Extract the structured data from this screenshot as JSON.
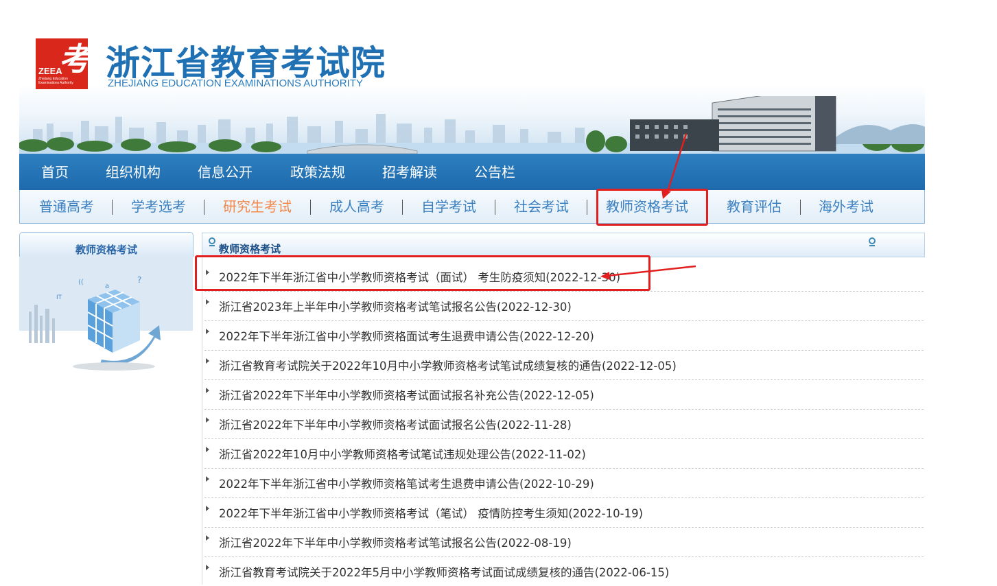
{
  "header": {
    "logo_char": "考",
    "logo_abbr": "ZEEA",
    "logo_sub": "Zhejiang Education Examinations Authority",
    "title": "浙江省教育考试院",
    "subtitle": "ZHEJIANG EDUCATION EXAMINATIONS AUTHORITY"
  },
  "nav_primary": [
    {
      "label": "首页"
    },
    {
      "label": "组织机构"
    },
    {
      "label": "信息公开"
    },
    {
      "label": "政策法规"
    },
    {
      "label": "招考解读"
    },
    {
      "label": "公告栏"
    }
  ],
  "nav_secondary": [
    {
      "label": "普通高考"
    },
    {
      "label": "学考选考"
    },
    {
      "label": "研究生考试"
    },
    {
      "label": "成人高考"
    },
    {
      "label": "自学考试"
    },
    {
      "label": "社会考试"
    },
    {
      "label": "教师资格考试"
    },
    {
      "label": "教育评估"
    },
    {
      "label": "海外考试"
    }
  ],
  "sidebar": {
    "title": "教师资格考试"
  },
  "main": {
    "title": "教师资格考试",
    "items": [
      "2022年下半年浙江省中小学教师资格考试（面试） 考生防疫须知(2022-12-30)",
      "浙江省2023年上半年中小学教师资格考试笔试报名公告(2022-12-30)",
      "2022年下半年浙江省中小学教师资格面试考生退费申请公告(2022-12-20)",
      "浙江省教育考试院关于2022年10月中小学教师资格考试笔试成绩复核的通告(2022-12-05)",
      "浙江省2022年下半年中小学教师资格考试面试报名补充公告(2022-12-05)",
      "浙江省2022年下半年中小学教师资格考试面试报名公告(2022-11-28)",
      "浙江省2022年10月中小学教师资格考试笔试违规处理公告(2022-11-02)",
      "2022年下半年浙江省中小学教师资格笔试考生退费申请公告(2022-10-29)",
      "2022年下半年浙江省中小学教师资格考试（笔试） 疫情防控考生须知(2022-10-19)",
      "浙江省2022年下半年中小学教师资格考试笔试报名公告(2022-08-19)",
      "浙江省教育考试院关于2022年5月中小学教师资格考试面试成绩复核的通告(2022-06-15)"
    ]
  },
  "colors": {
    "brand_blue": "#2070b4",
    "nav_blue": "#1e6aad",
    "active_orange": "#f3884b",
    "annotation_red": "#e21e1e",
    "logo_red": "#d9281b"
  }
}
